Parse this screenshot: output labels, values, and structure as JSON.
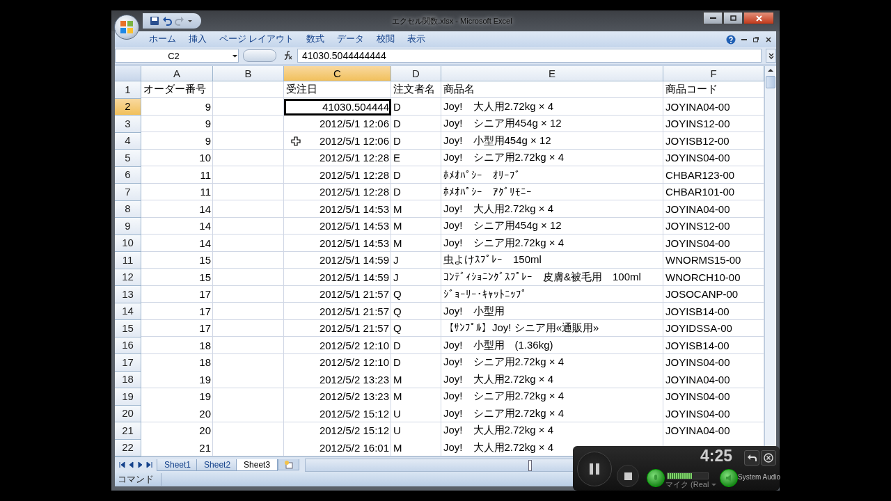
{
  "window": {
    "title": "エクセル関数.xlsx - Microsoft Excel"
  },
  "ribbon_tabs": [
    {
      "label": "ホーム",
      "selected": false
    },
    {
      "label": "挿入",
      "selected": false
    },
    {
      "label": "ページ レイアウト",
      "selected": false
    },
    {
      "label": "数式",
      "selected": false
    },
    {
      "label": "データ",
      "selected": false
    },
    {
      "label": "校閲",
      "selected": false
    },
    {
      "label": "表示",
      "selected": false
    }
  ],
  "formula_bar": {
    "name_box": "C2",
    "formula": "41030.5044444444"
  },
  "sheet": {
    "columns": [
      {
        "label": "A",
        "selected": false
      },
      {
        "label": "B",
        "selected": false
      },
      {
        "label": "C",
        "selected": true
      },
      {
        "label": "D",
        "selected": false
      },
      {
        "label": "E",
        "selected": false
      },
      {
        "label": "F",
        "selected": false
      }
    ],
    "rows": [
      {
        "header": "1",
        "selected": false,
        "cells": [
          "オーダー番号",
          null,
          "受注日",
          "注文者名",
          "商品名",
          "商品コード"
        ]
      },
      {
        "header": "2",
        "selected": true,
        "cells": [
          "9",
          null,
          "41030.504444",
          "D",
          "Joy!　大人用2.72kg × 4",
          "JOYINA04-00"
        ]
      },
      {
        "header": "3",
        "selected": false,
        "cells": [
          "9",
          null,
          "2012/5/1 12:06",
          "D",
          "Joy!　シニア用454g × 12",
          "JOYINS12-00"
        ]
      },
      {
        "header": "4",
        "selected": false,
        "cells": [
          "9",
          null,
          {
            "text": "2012/5/1 12:06",
            "cursor": true
          },
          "D",
          "Joy!　小型用454g × 12",
          "JOYISB12-00"
        ]
      },
      {
        "header": "5",
        "selected": false,
        "cells": [
          "10",
          null,
          "2012/5/1 12:28",
          "E",
          "Joy!　シニア用2.72kg × 4",
          "JOYINS04-00"
        ]
      },
      {
        "header": "6",
        "selected": false,
        "cells": [
          "11",
          null,
          "2012/5/1 12:28",
          "D",
          "ﾎﾒｵﾊﾟｼｰ　ｵﾘｰﾌﾞ",
          "CHBAR123-00"
        ]
      },
      {
        "header": "7",
        "selected": false,
        "cells": [
          "11",
          null,
          "2012/5/1 12:28",
          "D",
          "ﾎﾒｵﾊﾟｼｰ　ｱｸﾞﾘﾓﾆｰ",
          "CHBAR101-00"
        ]
      },
      {
        "header": "8",
        "selected": false,
        "cells": [
          "14",
          null,
          "2012/5/1 14:53",
          "M",
          "Joy!　大人用2.72kg × 4",
          "JOYINA04-00"
        ]
      },
      {
        "header": "9",
        "selected": false,
        "cells": [
          "14",
          null,
          "2012/5/1 14:53",
          "M",
          "Joy!　シニア用454g × 12",
          "JOYINS12-00"
        ]
      },
      {
        "header": "10",
        "selected": false,
        "cells": [
          "14",
          null,
          "2012/5/1 14:53",
          "M",
          "Joy!　シニア用2.72kg × 4",
          "JOYINS04-00"
        ]
      },
      {
        "header": "11",
        "selected": false,
        "cells": [
          "15",
          null,
          "2012/5/1 14:59",
          "J",
          "虫よけｽﾌﾟﾚｰ　150ml",
          "WNORMS15-00"
        ]
      },
      {
        "header": "12",
        "selected": false,
        "cells": [
          "15",
          null,
          "2012/5/1 14:59",
          "J",
          "ｺﾝﾃﾞｨｼｮﾆﾝｸﾞｽﾌﾟﾚｰ　皮膚&被毛用　100ml",
          "WNORCH10-00"
        ]
      },
      {
        "header": "13",
        "selected": false,
        "cells": [
          "17",
          null,
          "2012/5/1 21:57",
          "Q",
          "ｼﾞｮｰﾘｰ･ｷｬｯﾄﾆｯﾌﾟ",
          "JOSOCANP-00"
        ]
      },
      {
        "header": "14",
        "selected": false,
        "cells": [
          "17",
          null,
          "2012/5/1 21:57",
          "Q",
          "Joy!　小型用",
          "JOYISB14-00"
        ]
      },
      {
        "header": "15",
        "selected": false,
        "cells": [
          "17",
          null,
          "2012/5/1 21:57",
          "Q",
          "【ｻﾝﾌﾟﾙ】Joy! シニア用«通販用»",
          "JOYIDSSA-00"
        ]
      },
      {
        "header": "16",
        "selected": false,
        "cells": [
          "18",
          null,
          "2012/5/2 12:10",
          "D",
          "Joy!　小型用　(1.36kg)",
          "JOYISB14-00"
        ]
      },
      {
        "header": "17",
        "selected": false,
        "cells": [
          "18",
          null,
          "2012/5/2 12:10",
          "D",
          "Joy!　シニア用2.72kg × 4",
          "JOYINS04-00"
        ]
      },
      {
        "header": "18",
        "selected": false,
        "cells": [
          "19",
          null,
          "2012/5/2 13:23",
          "M",
          "Joy!　大人用2.72kg × 4",
          "JOYINA04-00"
        ]
      },
      {
        "header": "19",
        "selected": false,
        "cells": [
          "19",
          null,
          "2012/5/2 13:23",
          "M",
          "Joy!　シニア用2.72kg × 4",
          "JOYINS04-00"
        ]
      },
      {
        "header": "20",
        "selected": false,
        "cells": [
          "20",
          null,
          "2012/5/2 15:12",
          "U",
          "Joy!　シニア用2.72kg × 4",
          "JOYINS04-00"
        ]
      },
      {
        "header": "21",
        "selected": false,
        "cells": [
          "20",
          null,
          "2012/5/2 15:12",
          "U",
          "Joy!　大人用2.72kg × 4",
          "JOYINA04-00"
        ]
      },
      {
        "header": "22",
        "selected": false,
        "cells": [
          "21",
          null,
          "2012/5/2 16:01",
          "M",
          "Joy!　大人用2.72kg × 4",
          null
        ]
      }
    ]
  },
  "sheet_tabs": [
    {
      "label": "Sheet1",
      "selected": false
    },
    {
      "label": "Sheet2",
      "selected": false
    },
    {
      "label": "Sheet3",
      "selected": true
    }
  ],
  "status_bar": {
    "mode": "コマンド"
  },
  "recorder": {
    "time": "4:25",
    "microphone": {
      "label": "マイク (Real",
      "level": 0.6
    },
    "system_audio": {
      "label": "System Audio"
    }
  }
}
